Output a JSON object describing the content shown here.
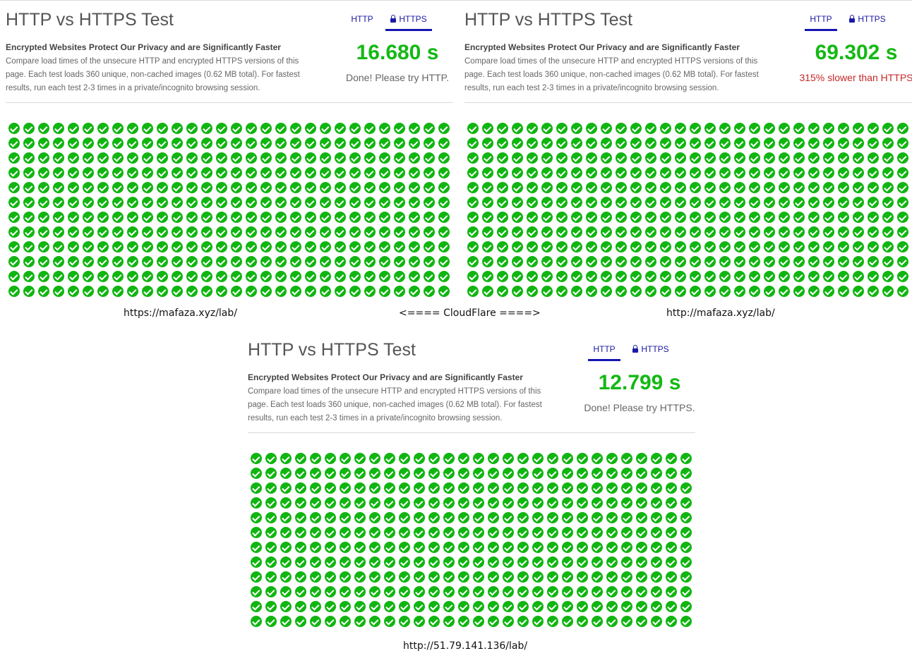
{
  "panels": [
    {
      "title": "HTTP vs HTTPS Test",
      "tabs": [
        {
          "label": "HTTP",
          "active": false
        },
        {
          "label": "HTTPS",
          "active": true
        }
      ],
      "subtitle": "Encrypted Websites Protect Our Privacy and are Significantly Faster",
      "description": "Compare load times of the unsecure HTTP and encrypted HTTPS versions of this page. Each test loads 360 unique, non-cached images (0.62 MB total). For fastest results, run each test 2-3 times in a private/incognito browsing session.",
      "time": "16.680 s",
      "message": "Done! Please try HTTP.",
      "message_color": "#666666",
      "grid": {
        "rows": 12,
        "cols": 30,
        "icon": "check-circle-icon",
        "color": "#11b511"
      },
      "caption": "https://mafaza.xyz/lab/"
    },
    {
      "title": "HTTP vs HTTPS Test",
      "tabs": [
        {
          "label": "HTTP",
          "active": true
        },
        {
          "label": "HTTPS",
          "active": false
        }
      ],
      "subtitle": "Encrypted Websites Protect Our Privacy and are Significantly Faster",
      "description": "Compare load times of the unsecure HTTP and encrypted HTTPS versions of this page. Each test loads 360 unique, non-cached images (0.62 MB total). For fastest results, run each test 2-3 times in a private/incognito browsing session.",
      "time": "69.302 s",
      "message": "315% slower than HTTPS",
      "message_color": "#c62828",
      "grid": {
        "rows": 12,
        "cols": 30,
        "icon": "check-circle-icon",
        "color": "#11b511"
      },
      "caption": "http://mafaza.xyz/lab/"
    },
    {
      "title": "HTTP vs HTTPS Test",
      "tabs": [
        {
          "label": "HTTP",
          "active": true
        },
        {
          "label": "HTTPS",
          "active": false
        }
      ],
      "subtitle": "Encrypted Websites Protect Our Privacy and are Significantly Faster",
      "description": "Compare load times of the unsecure HTTP and encrypted HTTPS versions of this page. Each test loads 360 unique, non-cached images (0.62 MB total). For fastest results, run each test 2-3 times in a private/incognito browsing session.",
      "time": "12.799 s",
      "message": "Done! Please try HTTPS.",
      "message_color": "#666666",
      "grid": {
        "rows": 12,
        "cols": 30,
        "icon": "check-circle-icon",
        "color": "#11b511"
      },
      "caption": "http://51.79.141.136/lab/"
    }
  ],
  "center_caption": "<==== CloudFlare ====>",
  "colors": {
    "time_green": "#13b913",
    "tab_blue": "#1a1aa8",
    "slow_red": "#c62828"
  }
}
